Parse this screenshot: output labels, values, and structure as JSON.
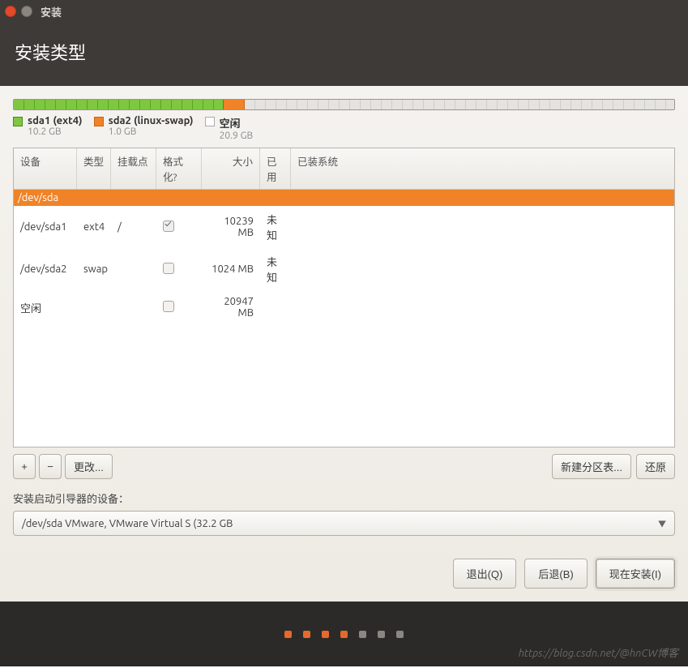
{
  "window": {
    "title": "安装"
  },
  "header": {
    "title": "安装类型"
  },
  "partitions": {
    "segments": [
      {
        "name": "sda1",
        "label": "sda1 (ext4)",
        "size_label": "10.2 GB",
        "color": "green",
        "pct": 31.8
      },
      {
        "name": "sda2",
        "label": "sda2 (linux-swap)",
        "size_label": "1.0 GB",
        "color": "orange",
        "pct": 3.2
      },
      {
        "name": "free",
        "label": "空闲",
        "size_label": "20.9 GB",
        "color": "free",
        "pct": 65.0
      }
    ]
  },
  "table": {
    "headers": {
      "device": "设备",
      "type": "类型",
      "mount": "挂载点",
      "format": "格式化?",
      "size": "大小",
      "used": "已用",
      "os": "已装系统"
    },
    "disk_row": "/dev/sda",
    "rows": [
      {
        "device": "/dev/sda1",
        "type": "ext4",
        "mount": "/",
        "format": true,
        "size": "10239 MB",
        "used": "未知",
        "os": ""
      },
      {
        "device": "/dev/sda2",
        "type": "swap",
        "mount": "",
        "format": false,
        "size": "1024 MB",
        "used": "未知",
        "os": ""
      },
      {
        "device": "空闲",
        "type": "",
        "mount": "",
        "format": false,
        "size": "20947 MB",
        "used": "",
        "os": ""
      }
    ]
  },
  "toolbar": {
    "add": "+",
    "remove": "−",
    "change": "更改...",
    "new_table": "新建分区表...",
    "revert": "还原"
  },
  "bootloader": {
    "label": "安装启动引导器的设备：",
    "value": "/dev/sda   VMware, VMware Virtual S (32.2 GB"
  },
  "nav": {
    "quit": "退出(Q)",
    "back": "后退(B)",
    "install": "现在安装(I)"
  },
  "watermark": "https://blog.csdn.net/@hnCW博客"
}
